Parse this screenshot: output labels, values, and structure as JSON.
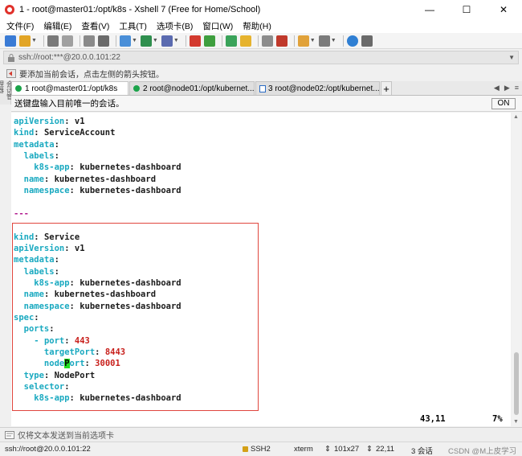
{
  "window": {
    "title": "1 - root@master01:/opt/k8s - Xshell 7 (Free for Home/School)",
    "minimize": "—",
    "maximize": "☐",
    "close": "✕"
  },
  "menu": {
    "items": [
      {
        "label": "文件(F)"
      },
      {
        "label": "编辑(E)"
      },
      {
        "label": "查看(V)"
      },
      {
        "label": "工具(T)"
      },
      {
        "label": "选项卡(B)"
      },
      {
        "label": "窗口(W)"
      },
      {
        "label": "帮助(H)"
      }
    ]
  },
  "address": {
    "value": "ssh://root:***@20.0.0.101:22"
  },
  "hint": {
    "text": "要添加当前会话，点击左侧的箭头按钮。"
  },
  "side_panel": {
    "label": "会话管理器"
  },
  "tabs": [
    {
      "label": "1 root@master01:/opt/k8s",
      "active": true
    },
    {
      "label": "2 root@node01:/opt/kubernet...",
      "active": false
    },
    {
      "label": "3 root@node02:/opt/kubernet...",
      "active": false
    }
  ],
  "send_bar": {
    "text": "送键盘输入目前唯一的会话。",
    "toggle": "ON"
  },
  "terminal": {
    "lines": [
      [
        {
          "t": "apiVersion",
          "c": "k"
        },
        {
          "t": ": ",
          "c": "v"
        },
        {
          "t": "v1",
          "c": "v"
        }
      ],
      [
        {
          "t": "kind",
          "c": "k"
        },
        {
          "t": ": ",
          "c": "v"
        },
        {
          "t": "ServiceAccount",
          "c": "v"
        }
      ],
      [
        {
          "t": "metadata",
          "c": "k"
        },
        {
          "t": ":",
          "c": "v"
        }
      ],
      [
        {
          "t": "  labels",
          "c": "k"
        },
        {
          "t": ":",
          "c": "v"
        }
      ],
      [
        {
          "t": "    k8s-app",
          "c": "k"
        },
        {
          "t": ": ",
          "c": "v"
        },
        {
          "t": "kubernetes-dashboard",
          "c": "v"
        }
      ],
      [
        {
          "t": "  name",
          "c": "k"
        },
        {
          "t": ": ",
          "c": "v"
        },
        {
          "t": "kubernetes-dashboard",
          "c": "v"
        }
      ],
      [
        {
          "t": "  namespace",
          "c": "k"
        },
        {
          "t": ": ",
          "c": "v"
        },
        {
          "t": "kubernetes-dashboard",
          "c": "v"
        }
      ],
      [],
      [
        {
          "t": "---",
          "c": "m"
        }
      ],
      [],
      [
        {
          "t": "kind",
          "c": "k"
        },
        {
          "t": ": ",
          "c": "v"
        },
        {
          "t": "Service",
          "c": "v"
        }
      ],
      [
        {
          "t": "apiVersion",
          "c": "k"
        },
        {
          "t": ": ",
          "c": "v"
        },
        {
          "t": "v1",
          "c": "v"
        }
      ],
      [
        {
          "t": "metadata",
          "c": "k"
        },
        {
          "t": ":",
          "c": "v"
        }
      ],
      [
        {
          "t": "  labels",
          "c": "k"
        },
        {
          "t": ":",
          "c": "v"
        }
      ],
      [
        {
          "t": "    k8s-app",
          "c": "k"
        },
        {
          "t": ": ",
          "c": "v"
        },
        {
          "t": "kubernetes-dashboard",
          "c": "v"
        }
      ],
      [
        {
          "t": "  name",
          "c": "k"
        },
        {
          "t": ": ",
          "c": "v"
        },
        {
          "t": "kubernetes-dashboard",
          "c": "v"
        }
      ],
      [
        {
          "t": "  namespace",
          "c": "k"
        },
        {
          "t": ": ",
          "c": "v"
        },
        {
          "t": "kubernetes-dashboard",
          "c": "v"
        }
      ],
      [
        {
          "t": "spec",
          "c": "k"
        },
        {
          "t": ":",
          "c": "v"
        }
      ],
      [
        {
          "t": "  ports",
          "c": "k"
        },
        {
          "t": ":",
          "c": "v"
        }
      ],
      [
        {
          "t": "    - ",
          "c": "k"
        },
        {
          "t": "port",
          "c": "k"
        },
        {
          "t": ": ",
          "c": "v"
        },
        {
          "t": "443",
          "c": "n"
        }
      ],
      [
        {
          "t": "      targetPort",
          "c": "k"
        },
        {
          "t": ": ",
          "c": "v"
        },
        {
          "t": "8443",
          "c": "n"
        }
      ],
      [
        {
          "t": "      node",
          "c": "k"
        },
        {
          "t": "P",
          "c": "cursor"
        },
        {
          "t": "ort",
          "c": "k"
        },
        {
          "t": ": ",
          "c": "v"
        },
        {
          "t": "30001",
          "c": "n"
        }
      ],
      [
        {
          "t": "  type",
          "c": "k"
        },
        {
          "t": ": ",
          "c": "v"
        },
        {
          "t": "NodePort",
          "c": "v"
        }
      ],
      [
        {
          "t": "  selector",
          "c": "k"
        },
        {
          "t": ":",
          "c": "v"
        }
      ],
      [
        {
          "t": "    k8s-app",
          "c": "k"
        },
        {
          "t": ": ",
          "c": "v"
        },
        {
          "t": "kubernetes-dashboard",
          "c": "v"
        }
      ]
    ],
    "cursor_pos": "43,11",
    "scroll_pct": "7%"
  },
  "compose": {
    "text": "仅将文本发送到当前选项卡"
  },
  "status": {
    "connection": "ssh://root@20.0.0.101:22",
    "protocol": "SSH2",
    "term": "xterm",
    "size": "101x27",
    "pos": "22,11",
    "sessions": "3 会话",
    "watermark": "CSDN @M上皮学习"
  },
  "colors": {
    "key": "#19a9c0",
    "number": "#c8201c",
    "separator": "#b0198e",
    "highlight_border": "#e0463e",
    "cursor": "#20e020"
  }
}
